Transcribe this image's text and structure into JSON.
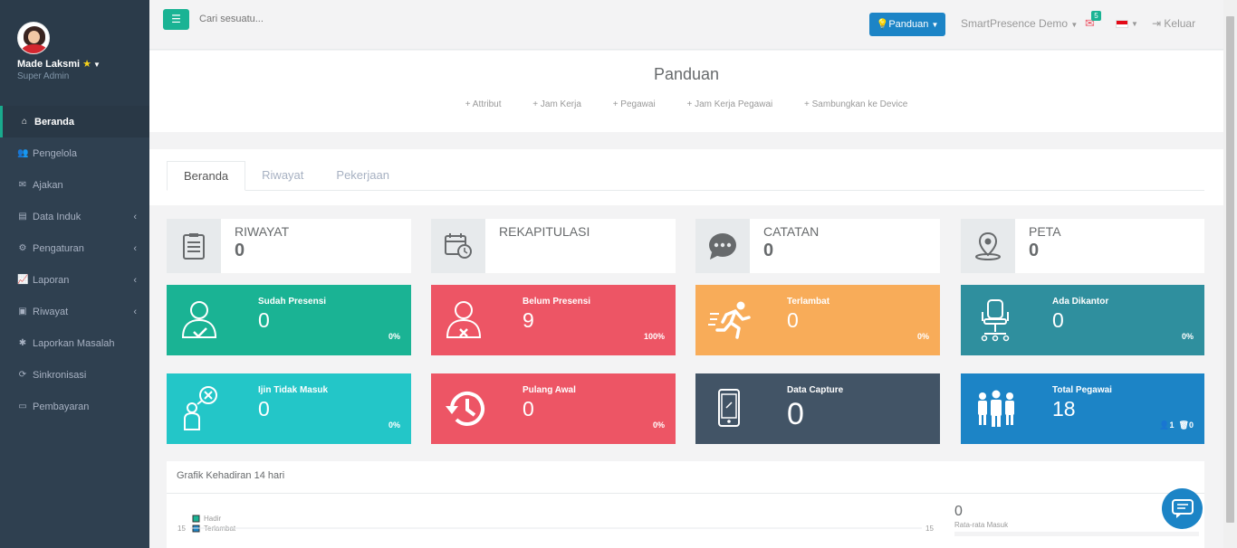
{
  "sidebar": {
    "user_name": "Made Laksmi",
    "user_role": "Super Admin",
    "items": [
      {
        "label": "Beranda",
        "icon": "home-icon"
      },
      {
        "label": "Pengelola",
        "icon": "users-icon"
      },
      {
        "label": "Ajakan",
        "icon": "envelope-icon"
      },
      {
        "label": "Data Induk",
        "icon": "book-icon"
      },
      {
        "label": "Pengaturan",
        "icon": "gears-icon"
      },
      {
        "label": "Laporan",
        "icon": "line-chart-icon"
      },
      {
        "label": "Riwayat",
        "icon": "file-icon"
      },
      {
        "label": "Laporkan Masalah",
        "icon": "bug-icon"
      },
      {
        "label": "Sinkronisasi",
        "icon": "refresh-icon"
      },
      {
        "label": "Pembayaran",
        "icon": "money-icon"
      }
    ]
  },
  "topbar": {
    "search_placeholder": "Cari sesuatu...",
    "panduan_label": "Panduan",
    "account_label": "SmartPresence Demo",
    "mail_count": "5",
    "logout_label": "Keluar"
  },
  "guide": {
    "title": "Panduan",
    "links": [
      "+ Attribut",
      "+ Jam Kerja",
      "+ Pegawai",
      "+ Jam Kerja Pegawai",
      "+ Sambungkan ke Device"
    ]
  },
  "tabs": [
    "Beranda",
    "Riwayat",
    "Pekerjaan"
  ],
  "widgets": [
    {
      "label": "RIWAYAT",
      "value": "0",
      "icon": "list-icon"
    },
    {
      "label": "REKAPITULASI",
      "value": "",
      "icon": "calendar-clock-icon"
    },
    {
      "label": "CATATAN",
      "value": "0",
      "icon": "chat-bubble-icon"
    },
    {
      "label": "PETA",
      "value": "0",
      "icon": "map-pin-icon"
    }
  ],
  "stats": [
    {
      "label": "Sudah Presensi",
      "value": "0",
      "pct": "0%",
      "color": "#1ab394",
      "icon": "user-check-icon"
    },
    {
      "label": "Belum Presensi",
      "value": "9",
      "pct": "100%",
      "color": "#ed5565",
      "icon": "user-x-icon"
    },
    {
      "label": "Terlambat",
      "value": "0",
      "pct": "0%",
      "color": "#f8ac59",
      "icon": "running-icon"
    },
    {
      "label": "Ada Dikantor",
      "value": "0",
      "pct": "0%",
      "color": "#2f8f9e",
      "icon": "office-chair-icon"
    },
    {
      "label": "Ijin Tidak Masuk",
      "value": "0",
      "pct": "0%",
      "color": "#23c6c8",
      "icon": "person-x-icon"
    },
    {
      "label": "Pulang Awal",
      "value": "0",
      "pct": "0%",
      "color": "#ed5565",
      "icon": "history-icon"
    },
    {
      "label": "Data Capture",
      "value": "0",
      "pct": "",
      "color": "#425466",
      "icon": "phone-icon"
    },
    {
      "label": "Total Pegawai",
      "value": "18",
      "extra_a": "1",
      "extra_b": "0",
      "color": "#1c84c6",
      "icon": "group-icon"
    }
  ],
  "chart": {
    "title": "Grafik Kehadiran 14 hari",
    "legend": [
      "Hadir",
      "Terlambat"
    ],
    "y_left": "15",
    "y_right": "15",
    "avg_value": "0",
    "avg_label": "Rata-rata Masuk",
    "avg_pct": "0%"
  }
}
